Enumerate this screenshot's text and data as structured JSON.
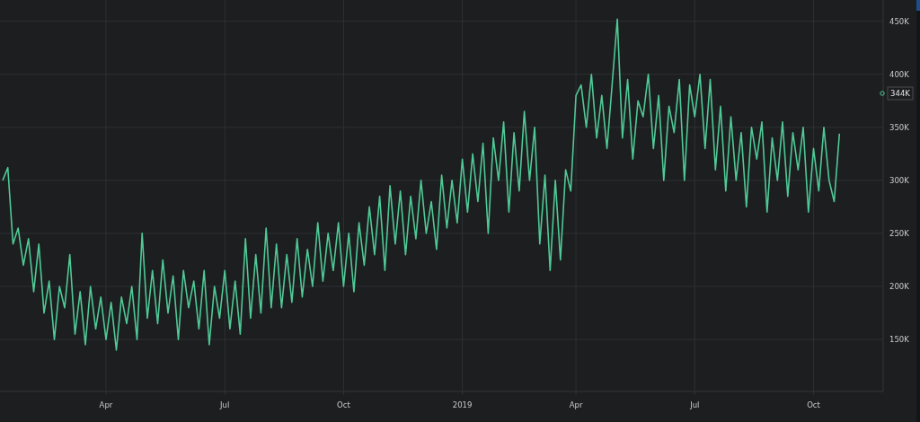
{
  "chart_data": {
    "type": "line",
    "categories": [
      null,
      null,
      null,
      null,
      null,
      null,
      null,
      null,
      null,
      null,
      null,
      null,
      null,
      null,
      null,
      null,
      null,
      null,
      null,
      null,
      "Apr",
      null,
      null,
      null,
      null,
      null,
      null,
      null,
      null,
      null,
      null,
      null,
      null,
      null,
      null,
      null,
      null,
      null,
      null,
      null,
      null,
      null,
      null,
      "Jul",
      null,
      null,
      null,
      null,
      null,
      null,
      null,
      null,
      null,
      null,
      null,
      null,
      null,
      null,
      null,
      null,
      null,
      null,
      null,
      null,
      null,
      null,
      "Oct",
      null,
      null,
      null,
      null,
      null,
      null,
      null,
      null,
      null,
      null,
      null,
      null,
      null,
      null,
      null,
      null,
      null,
      null,
      null,
      null,
      null,
      null,
      "2019",
      null,
      null,
      null,
      null,
      null,
      null,
      null,
      null,
      null,
      null,
      null,
      null,
      null,
      null,
      null,
      null,
      null,
      null,
      null,
      null,
      null,
      "Apr",
      null,
      null,
      null,
      null,
      null,
      null,
      null,
      null,
      null,
      null,
      null,
      null,
      null,
      null,
      null,
      null,
      null,
      null,
      null,
      null,
      null,
      null,
      "Jul",
      null,
      null,
      null,
      null,
      null,
      null,
      null,
      null,
      null,
      null,
      null,
      null,
      null,
      null,
      null,
      null,
      null,
      null,
      null,
      null,
      null,
      null,
      "Oct",
      null,
      null,
      null,
      null,
      null
    ],
    "series": [
      {
        "color": "#4fc996",
        "values": [
          300,
          312,
          240,
          255,
          220,
          245,
          195,
          240,
          175,
          205,
          150,
          200,
          180,
          230,
          155,
          195,
          145,
          200,
          160,
          190,
          150,
          185,
          140,
          190,
          165,
          200,
          150,
          250,
          170,
          215,
          165,
          225,
          175,
          210,
          150,
          215,
          180,
          205,
          160,
          215,
          145,
          200,
          170,
          215,
          160,
          205,
          155,
          245,
          170,
          230,
          175,
          255,
          180,
          240,
          180,
          230,
          185,
          245,
          190,
          235,
          200,
          260,
          205,
          250,
          215,
          260,
          200,
          250,
          195,
          260,
          220,
          275,
          230,
          285,
          215,
          295,
          240,
          290,
          230,
          285,
          245,
          300,
          250,
          280,
          235,
          305,
          255,
          300,
          260,
          320,
          270,
          325,
          280,
          335,
          250,
          340,
          300,
          355,
          270,
          345,
          290,
          365,
          300,
          350,
          240,
          305,
          215,
          300,
          225,
          310,
          290,
          380,
          390,
          350,
          400,
          340,
          380,
          330,
          390,
          452,
          340,
          395,
          320,
          375,
          360,
          400,
          330,
          380,
          300,
          370,
          345,
          395,
          300,
          390,
          360,
          400,
          330,
          395,
          310,
          370,
          290,
          360,
          300,
          345,
          275,
          350,
          320,
          355,
          270,
          340,
          300,
          355,
          285,
          345,
          310,
          350,
          270,
          330,
          290,
          350,
          300,
          280,
          344
        ]
      }
    ],
    "ylim": [
      101,
      470
    ],
    "grid": true,
    "yticks": [
      {
        "value": 150,
        "label": "150K"
      },
      {
        "value": 200,
        "label": "200K"
      },
      {
        "value": 250,
        "label": "250K"
      },
      {
        "value": 300,
        "label": "300K"
      },
      {
        "value": 350,
        "label": "350K"
      },
      {
        "value": 400,
        "label": "400K"
      },
      {
        "value": 450,
        "label": "450K"
      }
    ],
    "annotations": [
      "344K"
    ]
  }
}
